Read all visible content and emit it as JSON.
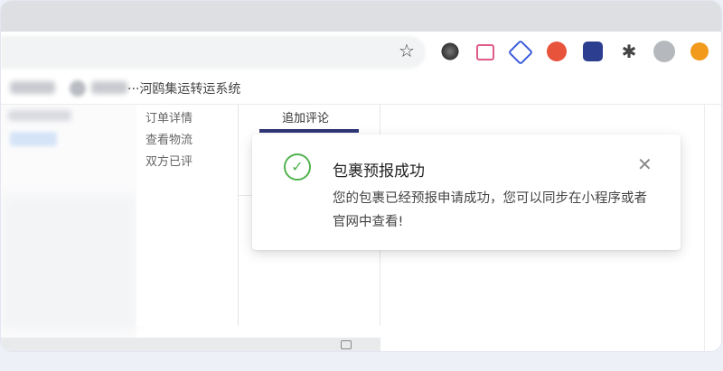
{
  "browser": {
    "bookmark_title": "···河鸥集运转运系统",
    "extensions": [
      "camera-icon",
      "tv-icon",
      "cube-icon",
      "infinity-icon",
      "flag-icon",
      "puzzle-icon",
      "profile-avatar",
      "upload-icon"
    ],
    "star_icon": "☆",
    "puzzle_glyph": "✱"
  },
  "order_nav": {
    "items": [
      "订单详情",
      "查看物流",
      "双方已评"
    ]
  },
  "review": {
    "add_comment_label": "追加评论"
  },
  "notification": {
    "icon": "✓",
    "title": "包裹预报成功",
    "message": "您的包裹已经预报申请成功，您可以同步在小程序或者官网中查看!",
    "close": "✕",
    "colors": {
      "success": "#52b34f"
    }
  }
}
